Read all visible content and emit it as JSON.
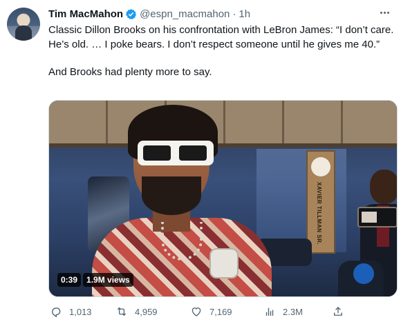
{
  "tweet": {
    "author_name": "Tim MacMahon",
    "handle": "@espn_macmahon",
    "separator": "·",
    "time": "1h",
    "paragraph_1": "Classic Dillon Brooks on his confrontation with LeBron James: “I don’t care. He’s old. … I poke bears. I don’t respect someone until he gives me 40.”",
    "paragraph_2": "And Brooks had plenty more to say."
  },
  "media": {
    "duration": "0:39",
    "views": "1.9M views",
    "plaque_text": "XAVIER TILLMAN SR."
  },
  "actions": {
    "replies": "1,013",
    "retweets": "4,959",
    "likes": "7,169",
    "views": "2.3M"
  },
  "colors": {
    "verified": "#1d9bf0",
    "text": "#0f1419",
    "muted": "#536471"
  },
  "icons": [
    "verified-badge-icon",
    "more-icon",
    "reply-icon",
    "retweet-icon",
    "like-icon",
    "views-icon",
    "share-icon"
  ]
}
